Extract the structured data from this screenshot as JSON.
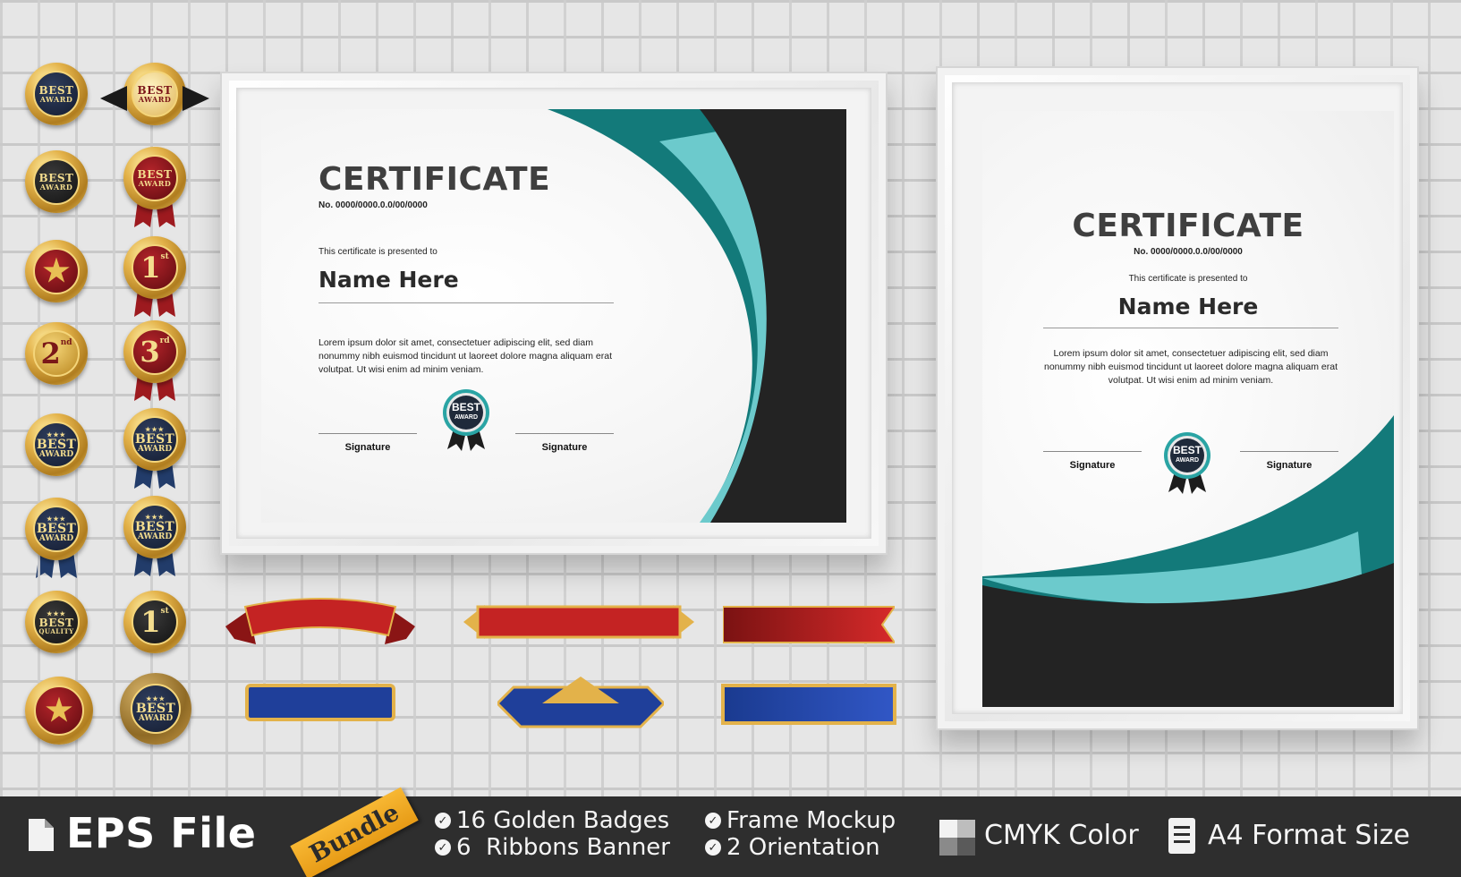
{
  "certificates": {
    "landscape": {
      "title": "CERTIFICATE",
      "number": "No. 0000/0000.0.0/00/0000",
      "presented": "This certificate is presented to",
      "name": "Name Here",
      "body": "Lorem ipsum dolor sit amet, consectetuer adipiscing elit, sed diam nonummy nibh euismod tincidunt ut laoreet dolore magna aliquam erat volutpat. Ut wisi enim ad minim veniam.",
      "seal_line1": "BEST",
      "seal_line2": "AWARD",
      "signature_left": "Signature",
      "signature_right": "Signature"
    },
    "portrait": {
      "title": "CERTIFICATE",
      "number": "No. 0000/0000.0.0/00/0000",
      "presented": "This certificate is presented to",
      "name": "Name Here",
      "body": "Lorem ipsum dolor sit amet, consectetuer adipiscing elit, sed diam nonummy nibh euismod tincidunt ut laoreet dolore magna aliquam erat volutpat. Ut wisi enim ad minim veniam.",
      "seal_line1": "BEST",
      "seal_line2": "AWARD",
      "signature_left": "Signature",
      "signature_right": "Signature"
    }
  },
  "badges": {
    "best": "BEST",
    "award": "AWARD",
    "quality": "QUALITY",
    "first": "1",
    "first_suffix": "st",
    "second": "2",
    "second_suffix": "nd",
    "third": "3",
    "third_suffix": "rd"
  },
  "colors": {
    "teal_dark": "#137a7a",
    "teal_light": "#6ccacc",
    "charcoal": "#232323",
    "footer_bg": "#2e2e2e",
    "bundle_tag": "#f0a623",
    "ribbon_red": "#b41f1f",
    "ribbon_blue": "#1f3f9a",
    "gold": "#e3b24a"
  },
  "footer": {
    "title": "EPS File",
    "bundle": "Bundle",
    "feature1": "16 Golden Badges",
    "feature2": "6  Ribbons Banner",
    "feature3": "Frame Mockup",
    "feature4": "2 Orientation",
    "color_mode": "CMYK Color",
    "format": "A4 Format Size"
  }
}
